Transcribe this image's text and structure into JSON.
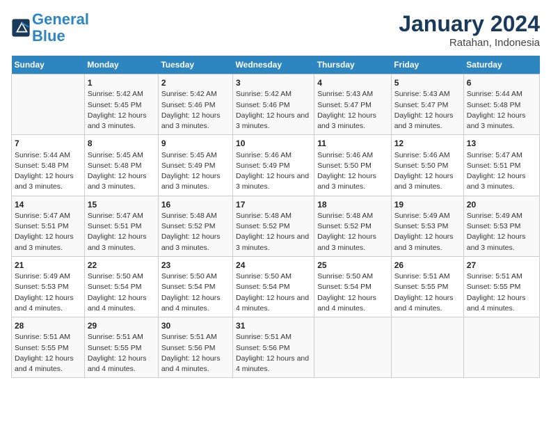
{
  "logo": {
    "line1": "General",
    "line2": "Blue"
  },
  "title": "January 2024",
  "subtitle": "Ratahan, Indonesia",
  "days_header": [
    "Sunday",
    "Monday",
    "Tuesday",
    "Wednesday",
    "Thursday",
    "Friday",
    "Saturday"
  ],
  "weeks": [
    [
      {
        "day": "",
        "sunrise": "",
        "sunset": "",
        "daylight": ""
      },
      {
        "day": "1",
        "sunrise": "Sunrise: 5:42 AM",
        "sunset": "Sunset: 5:45 PM",
        "daylight": "Daylight: 12 hours and 3 minutes."
      },
      {
        "day": "2",
        "sunrise": "Sunrise: 5:42 AM",
        "sunset": "Sunset: 5:46 PM",
        "daylight": "Daylight: 12 hours and 3 minutes."
      },
      {
        "day": "3",
        "sunrise": "Sunrise: 5:42 AM",
        "sunset": "Sunset: 5:46 PM",
        "daylight": "Daylight: 12 hours and 3 minutes."
      },
      {
        "day": "4",
        "sunrise": "Sunrise: 5:43 AM",
        "sunset": "Sunset: 5:47 PM",
        "daylight": "Daylight: 12 hours and 3 minutes."
      },
      {
        "day": "5",
        "sunrise": "Sunrise: 5:43 AM",
        "sunset": "Sunset: 5:47 PM",
        "daylight": "Daylight: 12 hours and 3 minutes."
      },
      {
        "day": "6",
        "sunrise": "Sunrise: 5:44 AM",
        "sunset": "Sunset: 5:48 PM",
        "daylight": "Daylight: 12 hours and 3 minutes."
      }
    ],
    [
      {
        "day": "7",
        "sunrise": "Sunrise: 5:44 AM",
        "sunset": "Sunset: 5:48 PM",
        "daylight": "Daylight: 12 hours and 3 minutes."
      },
      {
        "day": "8",
        "sunrise": "Sunrise: 5:45 AM",
        "sunset": "Sunset: 5:48 PM",
        "daylight": "Daylight: 12 hours and 3 minutes."
      },
      {
        "day": "9",
        "sunrise": "Sunrise: 5:45 AM",
        "sunset": "Sunset: 5:49 PM",
        "daylight": "Daylight: 12 hours and 3 minutes."
      },
      {
        "day": "10",
        "sunrise": "Sunrise: 5:46 AM",
        "sunset": "Sunset: 5:49 PM",
        "daylight": "Daylight: 12 hours and 3 minutes."
      },
      {
        "day": "11",
        "sunrise": "Sunrise: 5:46 AM",
        "sunset": "Sunset: 5:50 PM",
        "daylight": "Daylight: 12 hours and 3 minutes."
      },
      {
        "day": "12",
        "sunrise": "Sunrise: 5:46 AM",
        "sunset": "Sunset: 5:50 PM",
        "daylight": "Daylight: 12 hours and 3 minutes."
      },
      {
        "day": "13",
        "sunrise": "Sunrise: 5:47 AM",
        "sunset": "Sunset: 5:51 PM",
        "daylight": "Daylight: 12 hours and 3 minutes."
      }
    ],
    [
      {
        "day": "14",
        "sunrise": "Sunrise: 5:47 AM",
        "sunset": "Sunset: 5:51 PM",
        "daylight": "Daylight: 12 hours and 3 minutes."
      },
      {
        "day": "15",
        "sunrise": "Sunrise: 5:47 AM",
        "sunset": "Sunset: 5:51 PM",
        "daylight": "Daylight: 12 hours and 3 minutes."
      },
      {
        "day": "16",
        "sunrise": "Sunrise: 5:48 AM",
        "sunset": "Sunset: 5:52 PM",
        "daylight": "Daylight: 12 hours and 3 minutes."
      },
      {
        "day": "17",
        "sunrise": "Sunrise: 5:48 AM",
        "sunset": "Sunset: 5:52 PM",
        "daylight": "Daylight: 12 hours and 3 minutes."
      },
      {
        "day": "18",
        "sunrise": "Sunrise: 5:48 AM",
        "sunset": "Sunset: 5:52 PM",
        "daylight": "Daylight: 12 hours and 3 minutes."
      },
      {
        "day": "19",
        "sunrise": "Sunrise: 5:49 AM",
        "sunset": "Sunset: 5:53 PM",
        "daylight": "Daylight: 12 hours and 3 minutes."
      },
      {
        "day": "20",
        "sunrise": "Sunrise: 5:49 AM",
        "sunset": "Sunset: 5:53 PM",
        "daylight": "Daylight: 12 hours and 3 minutes."
      }
    ],
    [
      {
        "day": "21",
        "sunrise": "Sunrise: 5:49 AM",
        "sunset": "Sunset: 5:53 PM",
        "daylight": "Daylight: 12 hours and 4 minutes."
      },
      {
        "day": "22",
        "sunrise": "Sunrise: 5:50 AM",
        "sunset": "Sunset: 5:54 PM",
        "daylight": "Daylight: 12 hours and 4 minutes."
      },
      {
        "day": "23",
        "sunrise": "Sunrise: 5:50 AM",
        "sunset": "Sunset: 5:54 PM",
        "daylight": "Daylight: 12 hours and 4 minutes."
      },
      {
        "day": "24",
        "sunrise": "Sunrise: 5:50 AM",
        "sunset": "Sunset: 5:54 PM",
        "daylight": "Daylight: 12 hours and 4 minutes."
      },
      {
        "day": "25",
        "sunrise": "Sunrise: 5:50 AM",
        "sunset": "Sunset: 5:54 PM",
        "daylight": "Daylight: 12 hours and 4 minutes."
      },
      {
        "day": "26",
        "sunrise": "Sunrise: 5:51 AM",
        "sunset": "Sunset: 5:55 PM",
        "daylight": "Daylight: 12 hours and 4 minutes."
      },
      {
        "day": "27",
        "sunrise": "Sunrise: 5:51 AM",
        "sunset": "Sunset: 5:55 PM",
        "daylight": "Daylight: 12 hours and 4 minutes."
      }
    ],
    [
      {
        "day": "28",
        "sunrise": "Sunrise: 5:51 AM",
        "sunset": "Sunset: 5:55 PM",
        "daylight": "Daylight: 12 hours and 4 minutes."
      },
      {
        "day": "29",
        "sunrise": "Sunrise: 5:51 AM",
        "sunset": "Sunset: 5:55 PM",
        "daylight": "Daylight: 12 hours and 4 minutes."
      },
      {
        "day": "30",
        "sunrise": "Sunrise: 5:51 AM",
        "sunset": "Sunset: 5:56 PM",
        "daylight": "Daylight: 12 hours and 4 minutes."
      },
      {
        "day": "31",
        "sunrise": "Sunrise: 5:51 AM",
        "sunset": "Sunset: 5:56 PM",
        "daylight": "Daylight: 12 hours and 4 minutes."
      },
      {
        "day": "",
        "sunrise": "",
        "sunset": "",
        "daylight": ""
      },
      {
        "day": "",
        "sunrise": "",
        "sunset": "",
        "daylight": ""
      },
      {
        "day": "",
        "sunrise": "",
        "sunset": "",
        "daylight": ""
      }
    ]
  ]
}
